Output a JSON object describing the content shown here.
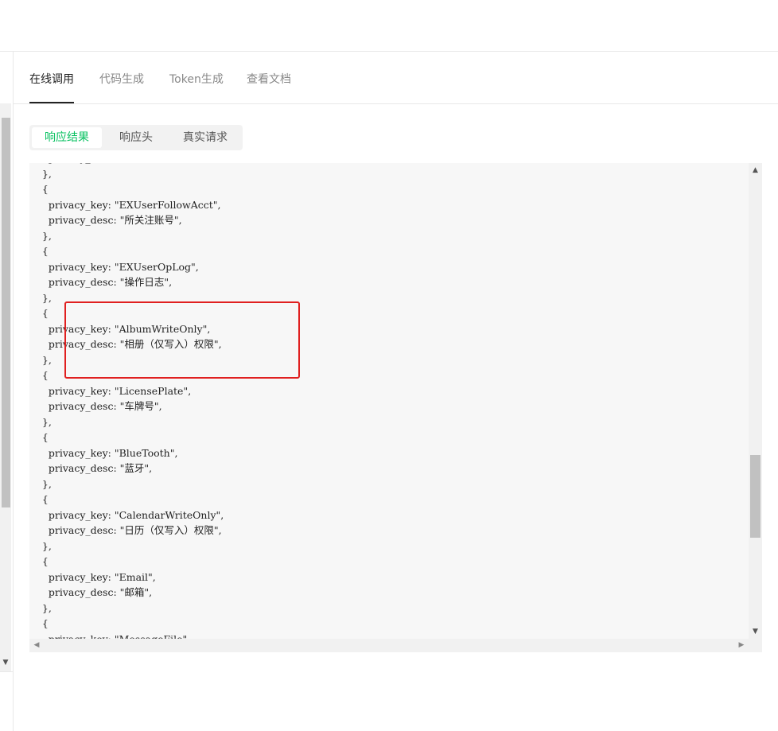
{
  "tabs": [
    {
      "label": "在线调用",
      "active": true
    },
    {
      "label": "代码生成",
      "active": false
    },
    {
      "label": "Token生成",
      "active": false
    },
    {
      "label": "查看文档",
      "active": false
    }
  ],
  "result_tabs": [
    {
      "label": "响应结果",
      "active": true
    },
    {
      "label": "响应头",
      "active": false
    },
    {
      "label": "真实请求",
      "active": false
    }
  ],
  "code_lines": [
    "      privacy_desc: \"...\",",
    "    },",
    "    {",
    "      privacy_key: \"EXUserFollowAcct\",",
    "      privacy_desc: \"所关注账号\",",
    "    },",
    "    {",
    "      privacy_key: \"EXUserOpLog\",",
    "      privacy_desc: \"操作日志\",",
    "    },",
    "    {",
    "      privacy_key: \"AlbumWriteOnly\",",
    "      privacy_desc: \"相册（仅写入）权限\",",
    "    },",
    "    {",
    "      privacy_key: \"LicensePlate\",",
    "      privacy_desc: \"车牌号\",",
    "    },",
    "    {",
    "      privacy_key: \"BlueTooth\",",
    "      privacy_desc: \"蓝牙\",",
    "    },",
    "    {",
    "      privacy_key: \"CalendarWriteOnly\",",
    "      privacy_desc: \"日历（仅写入）权限\",",
    "    },",
    "    {",
    "      privacy_key: \"Email\",",
    "      privacy_desc: \"邮箱\",",
    "    },",
    "    {",
    "      privacy_key: \"MessageFile\","
  ],
  "colors": {
    "accent": "#07c160",
    "highlight": "#e02020"
  }
}
